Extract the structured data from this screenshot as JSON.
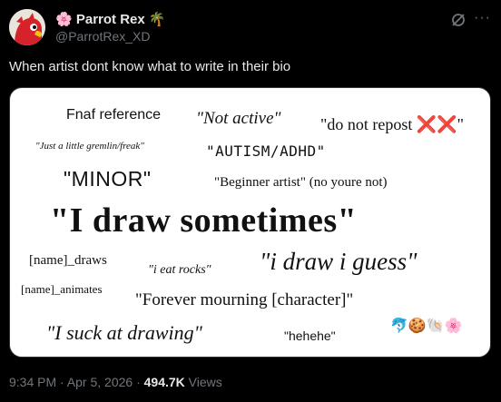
{
  "author": {
    "display_name": "Parrot Rex",
    "name_prefix_emoji": "🌸",
    "name_suffix_emoji": "🌴",
    "handle": "@ParrotRex_XD"
  },
  "header": {
    "grok_icon": "grok-icon",
    "more_icon": "more-icon",
    "more_label": "···"
  },
  "tweet": {
    "text": "When artist dont know what to write in their bio"
  },
  "image": {
    "phrases": {
      "fnaf": "Fnaf reference",
      "not_active": "\"Not active\"",
      "do_not_repost": "\"do not repost ",
      "do_not_repost_end": "\"",
      "crosses": "❌❌",
      "gremlin": "\"Just a little gremlin/freak\"",
      "autism": "\"AUTISM/ADHD\"",
      "minor": "\"MINOR\"",
      "beginner": "\"Beginner artist\" (no youre not)",
      "draw_sometimes": "\"I draw sometimes\"",
      "name_draws": "[name]_draws",
      "eat_rocks": "\"i eat rocks\"",
      "draw_guess": "\"i draw i guess\"",
      "name_animates": "[name]_animates",
      "mourning": "\"Forever mourning [character]\"",
      "suck": "\"I suck at drawing\"",
      "hehehe": "\"hehehe\"",
      "emojis": "🐬🍪🐚🌸"
    }
  },
  "meta": {
    "time": "9:34 PM · Apr 5, 2026 · ",
    "views_count": "494.7K",
    "views_label": " Views"
  }
}
